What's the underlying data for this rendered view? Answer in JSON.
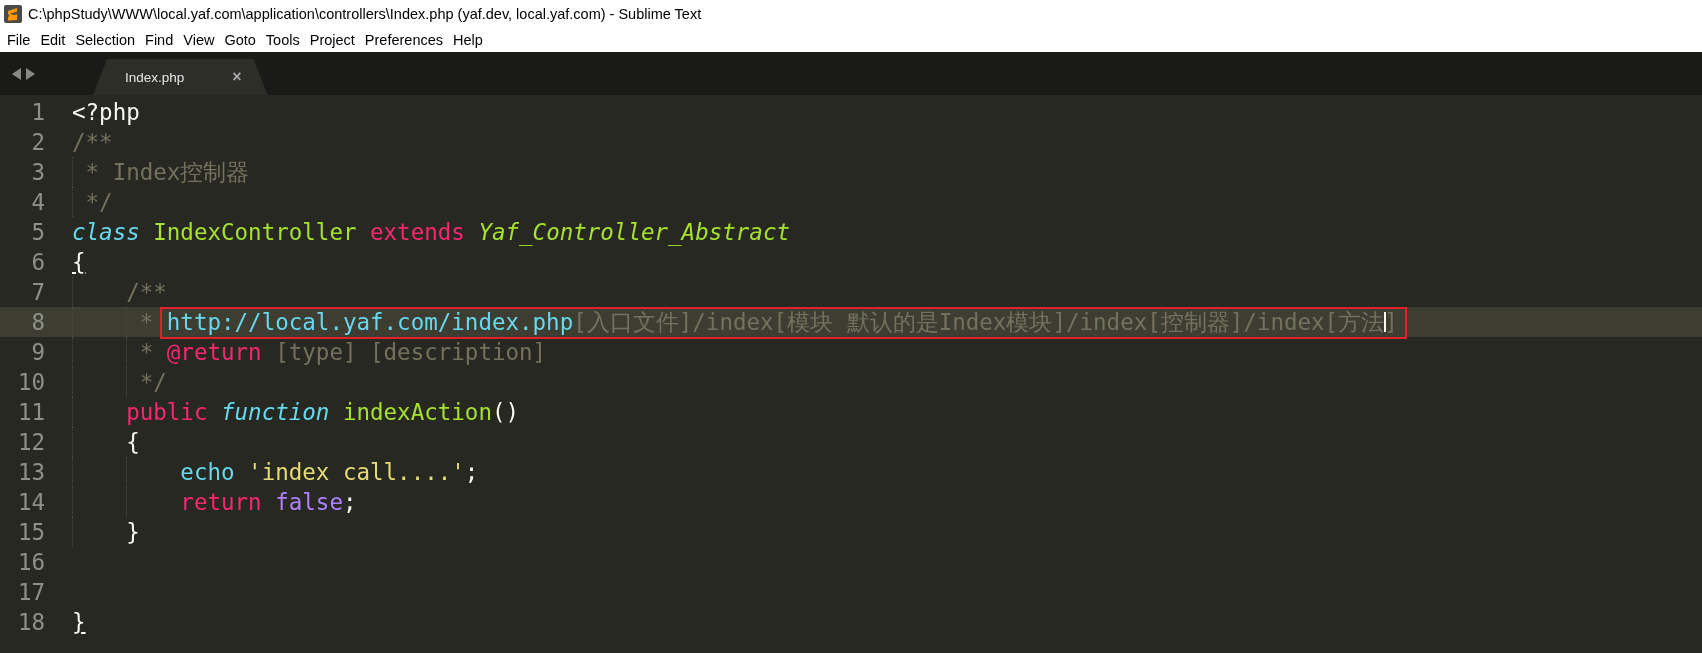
{
  "window": {
    "title": "C:\\phpStudy\\WWW\\local.yaf.com\\application\\controllers\\Index.php (yaf.dev, local.yaf.com) - Sublime Text"
  },
  "menu": [
    "File",
    "Edit",
    "Selection",
    "Find",
    "View",
    "Goto",
    "Tools",
    "Project",
    "Preferences",
    "Help"
  ],
  "tabs": [
    {
      "label": "Index.php",
      "selected": true,
      "close": "×"
    }
  ],
  "editor": {
    "lines": [
      {
        "number": "1",
        "current": false,
        "tokens": [
          {
            "kind": "plain",
            "text": "<?php"
          }
        ]
      },
      {
        "number": "2",
        "current": false,
        "tokens": [
          {
            "kind": "comment",
            "text": "/**"
          }
        ]
      },
      {
        "number": "3",
        "current": false,
        "tokens": [
          {
            "kind": "comment",
            "text": " * Index控制器"
          }
        ]
      },
      {
        "number": "4",
        "current": false,
        "tokens": [
          {
            "kind": "comment",
            "text": " */"
          }
        ]
      },
      {
        "number": "5",
        "current": false,
        "tokens": [
          {
            "kind": "storage",
            "text": "class "
          },
          {
            "kind": "entity",
            "text": "IndexController "
          },
          {
            "kind": "keyword",
            "text": "extends "
          },
          {
            "kind": "inherited",
            "text": "Yaf_Controller_Abstract"
          }
        ]
      },
      {
        "number": "6",
        "current": false,
        "tokens": [
          {
            "kind": "bracket-match",
            "text": "{"
          }
        ]
      },
      {
        "number": "7",
        "current": false,
        "tokens": [
          {
            "kind": "comment",
            "text": "    /**"
          }
        ]
      },
      {
        "number": "8",
        "current": true,
        "tokens": [
          {
            "kind": "comment",
            "text": "     * "
          },
          {
            "kind": "link",
            "text": "http://local.yaf.com/index.php",
            "boxed": true
          },
          {
            "kind": "comment",
            "text": "[入口文件]/index[模块 默认的是Index模块]/index[控制器]/index[方法",
            "boxed": true,
            "cursor_after": true
          },
          {
            "kind": "comment",
            "text": "]",
            "boxed": true
          }
        ]
      },
      {
        "number": "9",
        "current": false,
        "tokens": [
          {
            "kind": "comment",
            "text": "     * "
          },
          {
            "kind": "keyword",
            "text": "@return"
          },
          {
            "kind": "comment",
            "text": " [type] [description]"
          }
        ]
      },
      {
        "number": "10",
        "current": false,
        "tokens": [
          {
            "kind": "comment",
            "text": "     */"
          }
        ]
      },
      {
        "number": "11",
        "current": false,
        "tokens": [
          {
            "kind": "keyword",
            "text": "    public "
          },
          {
            "kind": "storage",
            "text": "function "
          },
          {
            "kind": "entity",
            "text": "indexAction"
          },
          {
            "kind": "plain",
            "text": "()"
          }
        ]
      },
      {
        "number": "12",
        "current": false,
        "tokens": [
          {
            "kind": "plain",
            "text": "    {"
          }
        ]
      },
      {
        "number": "13",
        "current": false,
        "tokens": [
          {
            "kind": "support",
            "text": "        echo "
          },
          {
            "kind": "string",
            "text": "'index call....'"
          },
          {
            "kind": "plain",
            "text": ";"
          }
        ]
      },
      {
        "number": "14",
        "current": false,
        "tokens": [
          {
            "kind": "keyword",
            "text": "        return "
          },
          {
            "kind": "constant",
            "text": "false"
          },
          {
            "kind": "plain",
            "text": ";"
          }
        ]
      },
      {
        "number": "15",
        "current": false,
        "tokens": [
          {
            "kind": "plain",
            "text": "    }"
          }
        ]
      },
      {
        "number": "16",
        "current": false
      },
      {
        "number": "17",
        "current": false
      },
      {
        "number": "18",
        "current": false,
        "tokens": [
          {
            "kind": "bracket-match",
            "text": "}"
          }
        ]
      }
    ]
  }
}
